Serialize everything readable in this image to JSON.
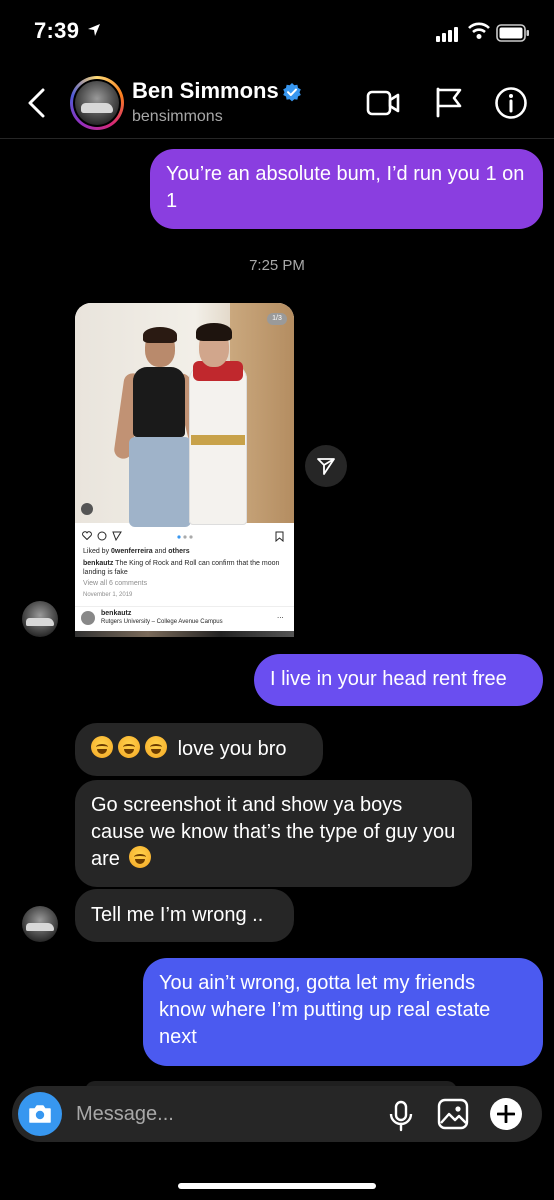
{
  "status_bar": {
    "time": "7:39"
  },
  "header": {
    "title": "Ben Simmons",
    "username": "bensimmons"
  },
  "messages": {
    "m1": "You’re an absolute bum, I’d run you 1 on 1",
    "timestamp": "7:25 PM",
    "m2": "I live in your head rent free",
    "t1": "love you bro",
    "t2": "Go screenshot it and show ya boys cause we know that’s the type of guy you are",
    "t3": "Tell me I’m wrong ..",
    "m3": "You ain’t wrong, gotta let my friends know where I’m putting up real estate next"
  },
  "shared_post": {
    "counter": "1/3",
    "liked_by_user": "0wenferreira",
    "liked_by_others": "others",
    "caption_user": "benkautz",
    "caption_text": "The King of Rock and Roll can confirm that the moon landing is fake",
    "view_comments": "View all 6 comments",
    "date": "November 1, 2019",
    "footer_user": "benkautz",
    "footer_location": "Rutgers University – College Avenue Campus",
    "footer_more": "..."
  },
  "composer": {
    "placeholder": "Message..."
  },
  "colors": {
    "outgoing_1": "#8a3ee0",
    "outgoing_2": "#6a4ef0",
    "outgoing_3": "#4b5af0",
    "incoming": "#262626",
    "camera": "#3797f0",
    "verified": "#3897f0"
  }
}
